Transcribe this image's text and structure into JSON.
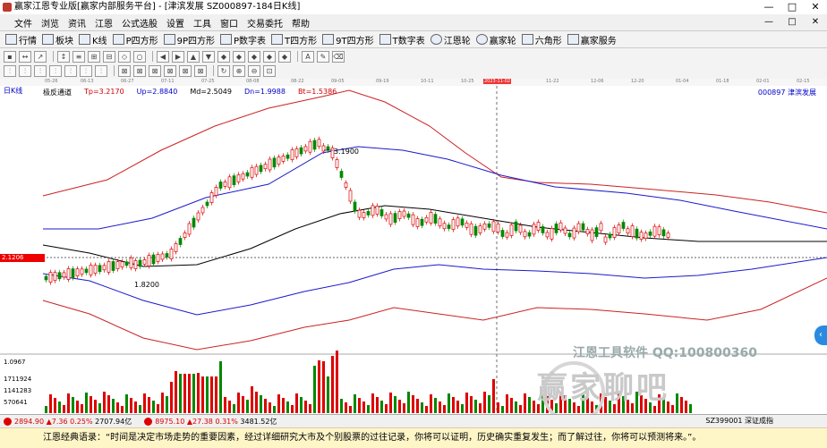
{
  "window": {
    "title": "赢家江恩专业版[赢家内部服务平台] - [津滨发展  SZ000897-184日K线]",
    "minimize": "—",
    "maximize": "□",
    "close": "✕"
  },
  "menu": {
    "items": [
      "文件",
      "浏览",
      "资讯",
      "江恩",
      "公式选股",
      "设置",
      "工具",
      "窗口",
      "交易委托",
      "帮助"
    ]
  },
  "toolbar1": {
    "items": [
      "行情",
      "板块",
      "K线",
      "P四方形",
      "9P四方形",
      "P数字表",
      "T四方形",
      "9T四方形",
      "T数字表",
      "江恩轮",
      "赢家轮",
      "六角形",
      "赢家服务"
    ]
  },
  "dates": {
    "labels": [
      "05-26",
      "06-13",
      "06-27",
      "07-11",
      "07-25",
      "08-08",
      "08-22",
      "09-05",
      "09-19",
      "10-11",
      "10-25",
      "2023-11-02",
      "11-22",
      "12-06",
      "12-20",
      "01-04",
      "01-18",
      "02-01",
      "02-15"
    ]
  },
  "chart": {
    "klabel": "日K线",
    "indicator_name": "极反通道",
    "tp": "Tp=3.2170",
    "up": "Up=2.8840",
    "md": "Md=2.5049",
    "dn": "Dn=1.9988",
    "bt": "Bt=1.5386",
    "code": "000897  津滨发展",
    "price_tag": "2.1206",
    "high_label": "3.1900",
    "low_label": "1.8200",
    "colors": {
      "up": "#dd0000",
      "down": "#008800",
      "outer": "#cc2222",
      "inner": "#1a1acc",
      "mid": "#000000"
    }
  },
  "volume": {
    "ticks": [
      "1.0967",
      "1711924",
      "1141283",
      "570641"
    ]
  },
  "watermark": {
    "text": "江恩工具软件  QQ:100800360",
    "big": "赢家聊吧"
  },
  "statusbar": {
    "sh": "2894.90",
    "sh_chg": "▲7.36 0.25%",
    "sh_amt": "2707.94亿",
    "sz": "8975.10",
    "sz_chg": "▲27.38 0.31%",
    "sz_amt": "3481.52亿",
    "right": "SZ399001 深证成指"
  },
  "quote": "江恩经典语录：“时间是决定市场走势的重要因素，经过详细研究大市及个别股票的过往记录，你将可以证明，历史确实重复发生；而了解过往，你将可以预测将来。”。"
}
